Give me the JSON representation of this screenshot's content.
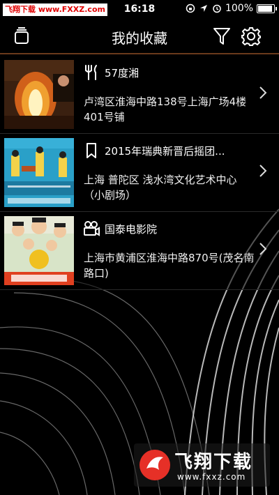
{
  "status_bar": {
    "carrier": "飞翔下载 www.FXXZ.com",
    "time": "16:18",
    "battery_percent": "100%",
    "battery_level": 1.0
  },
  "nav": {
    "title": "我的收藏",
    "left_icon": "stack-icon",
    "filter_icon": "filter-icon",
    "settings_icon": "gear-icon"
  },
  "favorites": [
    {
      "category_icon": "fork-knife-icon",
      "title": "57度湘",
      "address": "卢湾区淮海中路138号上海广场4楼401号铺"
    },
    {
      "category_icon": "bookmark-icon",
      "title": "2015年瑞典新晋后摇团...",
      "address": "上海 普陀区 浅水湾文化艺术中心（小剧场）"
    },
    {
      "category_icon": "movie-camera-icon",
      "title": "国泰电影院",
      "address": "上海市黄浦区淮海中路870号(茂名南路口)"
    }
  ],
  "watermark": {
    "name": "飞翔下载",
    "url": "www.fxxz.com"
  },
  "colors": {
    "accent_line": "#6a3a1c",
    "carrier_red": "#e00000"
  }
}
